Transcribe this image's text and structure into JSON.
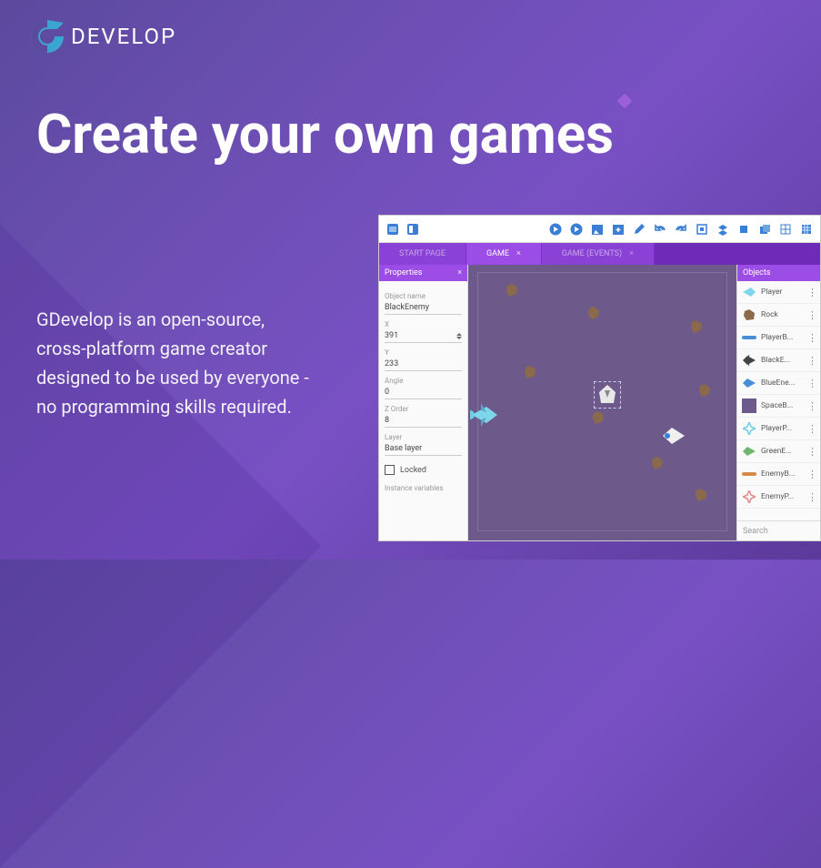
{
  "logo": {
    "text": "DEVELOP"
  },
  "headline": "Create your own games",
  "description": "GDevelop is an open-source, cross-platform game creator designed to be used by everyone - no programming skills required.",
  "editor": {
    "tabs": [
      {
        "label": "START PAGE"
      },
      {
        "label": "GAME",
        "active": true
      },
      {
        "label": "GAME (EVENTS)"
      }
    ],
    "properties_panel": {
      "title": "Properties",
      "object_name_label": "Object name",
      "object_name": "BlackEnemy",
      "x_label": "X",
      "x": "391",
      "y_label": "Y",
      "y": "233",
      "angle_label": "Angle",
      "angle": "0",
      "zorder_label": "Z Order",
      "zorder": "8",
      "layer_label": "Layer",
      "layer": "Base layer",
      "locked_label": "Locked",
      "instance_vars_label": "Instance variables"
    },
    "objects_panel": {
      "title": "Objects",
      "items": [
        {
          "label": "Player"
        },
        {
          "label": "Rock"
        },
        {
          "label": "PlayerB..."
        },
        {
          "label": "BlackE..."
        },
        {
          "label": "BlueEne..."
        },
        {
          "label": "SpaceB..."
        },
        {
          "label": "PlayerP..."
        },
        {
          "label": "GreenE..."
        },
        {
          "label": "EnemyB..."
        },
        {
          "label": "EnemyP..."
        }
      ],
      "search_placeholder": "Search"
    }
  }
}
